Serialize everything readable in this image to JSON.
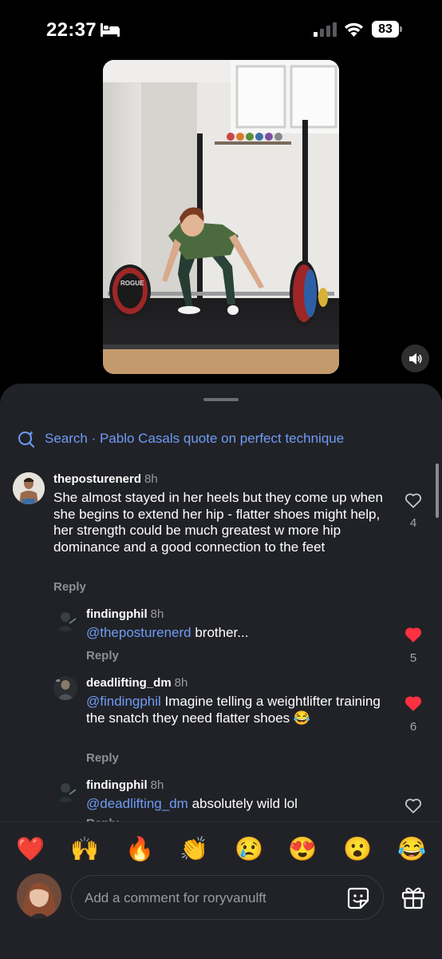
{
  "status_bar": {
    "time": "22:37",
    "battery": "83"
  },
  "video": {
    "plate_text": "ROGUE"
  },
  "search": {
    "label": "Search · Pablo Casals quote on perfect technique"
  },
  "comments": [
    {
      "user": "theposturenerd",
      "time": "8h",
      "text": "She almost stayed in her heels but they come up when she begins to extend her hip - flatter shoes might help, her strength could be much greatest w more hip dominance and a good connection to the feet",
      "reply": "Reply",
      "likes": "4",
      "liked": false
    },
    {
      "user": "findingphil",
      "time": "8h",
      "mention": "@theposturenerd",
      "text": " brother...",
      "reply": "Reply",
      "likes": "5",
      "liked": true
    },
    {
      "user": "deadlifting_dm",
      "time": "8h",
      "mention": "@findingphil",
      "text": " Imagine telling a weightlifter training the snatch they need flatter shoes 😂",
      "reply": "Reply",
      "likes": "6",
      "liked": true
    },
    {
      "user": "findingphil",
      "time": "8h",
      "mention": "@deadlifting_dm",
      "text": " absolutely wild lol",
      "reply": "Reply",
      "likes": "",
      "liked": false
    }
  ],
  "reactions": [
    "❤️",
    "🙌",
    "🔥",
    "👏",
    "😢",
    "😍",
    "😮",
    "😂"
  ],
  "composer": {
    "placeholder": "Add a comment for roryvanulft"
  },
  "colors": {
    "sheet": "#212227",
    "link": "#6f9cf5",
    "heart": "#ff3040"
  },
  "icons": [
    "bed-icon",
    "signal-icon",
    "wifi-icon",
    "volume-icon",
    "search-icon",
    "heart-icon",
    "sticker-icon",
    "gift-icon"
  ]
}
